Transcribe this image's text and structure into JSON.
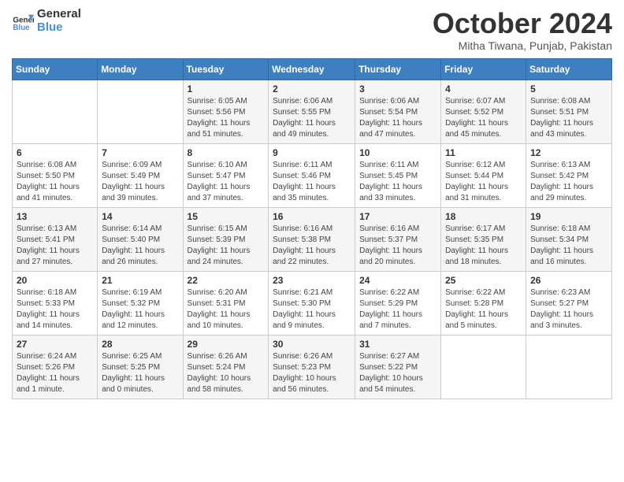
{
  "logo": {
    "line1": "General",
    "line2": "Blue"
  },
  "title": "October 2024",
  "subtitle": "Mitha Tiwana, Punjab, Pakistan",
  "days_of_week": [
    "Sunday",
    "Monday",
    "Tuesday",
    "Wednesday",
    "Thursday",
    "Friday",
    "Saturday"
  ],
  "weeks": [
    [
      {
        "day": "",
        "info": ""
      },
      {
        "day": "",
        "info": ""
      },
      {
        "day": "1",
        "info": "Sunrise: 6:05 AM\nSunset: 5:56 PM\nDaylight: 11 hours and 51 minutes."
      },
      {
        "day": "2",
        "info": "Sunrise: 6:06 AM\nSunset: 5:55 PM\nDaylight: 11 hours and 49 minutes."
      },
      {
        "day": "3",
        "info": "Sunrise: 6:06 AM\nSunset: 5:54 PM\nDaylight: 11 hours and 47 minutes."
      },
      {
        "day": "4",
        "info": "Sunrise: 6:07 AM\nSunset: 5:52 PM\nDaylight: 11 hours and 45 minutes."
      },
      {
        "day": "5",
        "info": "Sunrise: 6:08 AM\nSunset: 5:51 PM\nDaylight: 11 hours and 43 minutes."
      }
    ],
    [
      {
        "day": "6",
        "info": "Sunrise: 6:08 AM\nSunset: 5:50 PM\nDaylight: 11 hours and 41 minutes."
      },
      {
        "day": "7",
        "info": "Sunrise: 6:09 AM\nSunset: 5:49 PM\nDaylight: 11 hours and 39 minutes."
      },
      {
        "day": "8",
        "info": "Sunrise: 6:10 AM\nSunset: 5:47 PM\nDaylight: 11 hours and 37 minutes."
      },
      {
        "day": "9",
        "info": "Sunrise: 6:11 AM\nSunset: 5:46 PM\nDaylight: 11 hours and 35 minutes."
      },
      {
        "day": "10",
        "info": "Sunrise: 6:11 AM\nSunset: 5:45 PM\nDaylight: 11 hours and 33 minutes."
      },
      {
        "day": "11",
        "info": "Sunrise: 6:12 AM\nSunset: 5:44 PM\nDaylight: 11 hours and 31 minutes."
      },
      {
        "day": "12",
        "info": "Sunrise: 6:13 AM\nSunset: 5:42 PM\nDaylight: 11 hours and 29 minutes."
      }
    ],
    [
      {
        "day": "13",
        "info": "Sunrise: 6:13 AM\nSunset: 5:41 PM\nDaylight: 11 hours and 27 minutes."
      },
      {
        "day": "14",
        "info": "Sunrise: 6:14 AM\nSunset: 5:40 PM\nDaylight: 11 hours and 26 minutes."
      },
      {
        "day": "15",
        "info": "Sunrise: 6:15 AM\nSunset: 5:39 PM\nDaylight: 11 hours and 24 minutes."
      },
      {
        "day": "16",
        "info": "Sunrise: 6:16 AM\nSunset: 5:38 PM\nDaylight: 11 hours and 22 minutes."
      },
      {
        "day": "17",
        "info": "Sunrise: 6:16 AM\nSunset: 5:37 PM\nDaylight: 11 hours and 20 minutes."
      },
      {
        "day": "18",
        "info": "Sunrise: 6:17 AM\nSunset: 5:35 PM\nDaylight: 11 hours and 18 minutes."
      },
      {
        "day": "19",
        "info": "Sunrise: 6:18 AM\nSunset: 5:34 PM\nDaylight: 11 hours and 16 minutes."
      }
    ],
    [
      {
        "day": "20",
        "info": "Sunrise: 6:18 AM\nSunset: 5:33 PM\nDaylight: 11 hours and 14 minutes."
      },
      {
        "day": "21",
        "info": "Sunrise: 6:19 AM\nSunset: 5:32 PM\nDaylight: 11 hours and 12 minutes."
      },
      {
        "day": "22",
        "info": "Sunrise: 6:20 AM\nSunset: 5:31 PM\nDaylight: 11 hours and 10 minutes."
      },
      {
        "day": "23",
        "info": "Sunrise: 6:21 AM\nSunset: 5:30 PM\nDaylight: 11 hours and 9 minutes."
      },
      {
        "day": "24",
        "info": "Sunrise: 6:22 AM\nSunset: 5:29 PM\nDaylight: 11 hours and 7 minutes."
      },
      {
        "day": "25",
        "info": "Sunrise: 6:22 AM\nSunset: 5:28 PM\nDaylight: 11 hours and 5 minutes."
      },
      {
        "day": "26",
        "info": "Sunrise: 6:23 AM\nSunset: 5:27 PM\nDaylight: 11 hours and 3 minutes."
      }
    ],
    [
      {
        "day": "27",
        "info": "Sunrise: 6:24 AM\nSunset: 5:26 PM\nDaylight: 11 hours and 1 minute."
      },
      {
        "day": "28",
        "info": "Sunrise: 6:25 AM\nSunset: 5:25 PM\nDaylight: 11 hours and 0 minutes."
      },
      {
        "day": "29",
        "info": "Sunrise: 6:26 AM\nSunset: 5:24 PM\nDaylight: 10 hours and 58 minutes."
      },
      {
        "day": "30",
        "info": "Sunrise: 6:26 AM\nSunset: 5:23 PM\nDaylight: 10 hours and 56 minutes."
      },
      {
        "day": "31",
        "info": "Sunrise: 6:27 AM\nSunset: 5:22 PM\nDaylight: 10 hours and 54 minutes."
      },
      {
        "day": "",
        "info": ""
      },
      {
        "day": "",
        "info": ""
      }
    ]
  ]
}
